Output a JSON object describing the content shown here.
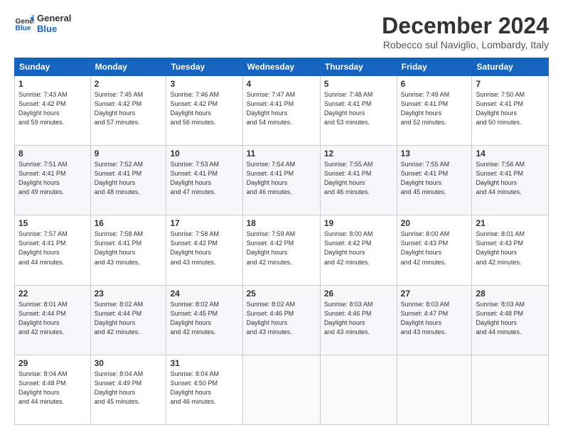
{
  "header": {
    "logo_line1": "General",
    "logo_line2": "Blue",
    "month_title": "December 2024",
    "location": "Robecco sul Naviglio, Lombardy, Italy"
  },
  "days_of_week": [
    "Sunday",
    "Monday",
    "Tuesday",
    "Wednesday",
    "Thursday",
    "Friday",
    "Saturday"
  ],
  "weeks": [
    [
      {
        "day": "1",
        "sunrise": "7:43 AM",
        "sunset": "4:42 PM",
        "daylight": "8 hours and 59 minutes."
      },
      {
        "day": "2",
        "sunrise": "7:45 AM",
        "sunset": "4:42 PM",
        "daylight": "8 hours and 57 minutes."
      },
      {
        "day": "3",
        "sunrise": "7:46 AM",
        "sunset": "4:42 PM",
        "daylight": "8 hours and 56 minutes."
      },
      {
        "day": "4",
        "sunrise": "7:47 AM",
        "sunset": "4:41 PM",
        "daylight": "8 hours and 54 minutes."
      },
      {
        "day": "5",
        "sunrise": "7:48 AM",
        "sunset": "4:41 PM",
        "daylight": "8 hours and 53 minutes."
      },
      {
        "day": "6",
        "sunrise": "7:49 AM",
        "sunset": "4:41 PM",
        "daylight": "8 hours and 52 minutes."
      },
      {
        "day": "7",
        "sunrise": "7:50 AM",
        "sunset": "4:41 PM",
        "daylight": "8 hours and 50 minutes."
      }
    ],
    [
      {
        "day": "8",
        "sunrise": "7:51 AM",
        "sunset": "4:41 PM",
        "daylight": "8 hours and 49 minutes."
      },
      {
        "day": "9",
        "sunrise": "7:52 AM",
        "sunset": "4:41 PM",
        "daylight": "8 hours and 48 minutes."
      },
      {
        "day": "10",
        "sunrise": "7:53 AM",
        "sunset": "4:41 PM",
        "daylight": "8 hours and 47 minutes."
      },
      {
        "day": "11",
        "sunrise": "7:54 AM",
        "sunset": "4:41 PM",
        "daylight": "8 hours and 46 minutes."
      },
      {
        "day": "12",
        "sunrise": "7:55 AM",
        "sunset": "4:41 PM",
        "daylight": "8 hours and 46 minutes."
      },
      {
        "day": "13",
        "sunrise": "7:55 AM",
        "sunset": "4:41 PM",
        "daylight": "8 hours and 45 minutes."
      },
      {
        "day": "14",
        "sunrise": "7:56 AM",
        "sunset": "4:41 PM",
        "daylight": "8 hours and 44 minutes."
      }
    ],
    [
      {
        "day": "15",
        "sunrise": "7:57 AM",
        "sunset": "4:41 PM",
        "daylight": "8 hours and 44 minutes."
      },
      {
        "day": "16",
        "sunrise": "7:58 AM",
        "sunset": "4:41 PM",
        "daylight": "8 hours and 43 minutes."
      },
      {
        "day": "17",
        "sunrise": "7:58 AM",
        "sunset": "4:42 PM",
        "daylight": "8 hours and 43 minutes."
      },
      {
        "day": "18",
        "sunrise": "7:59 AM",
        "sunset": "4:42 PM",
        "daylight": "8 hours and 42 minutes."
      },
      {
        "day": "19",
        "sunrise": "8:00 AM",
        "sunset": "4:42 PM",
        "daylight": "8 hours and 42 minutes."
      },
      {
        "day": "20",
        "sunrise": "8:00 AM",
        "sunset": "4:43 PM",
        "daylight": "8 hours and 42 minutes."
      },
      {
        "day": "21",
        "sunrise": "8:01 AM",
        "sunset": "4:43 PM",
        "daylight": "8 hours and 42 minutes."
      }
    ],
    [
      {
        "day": "22",
        "sunrise": "8:01 AM",
        "sunset": "4:44 PM",
        "daylight": "8 hours and 42 minutes."
      },
      {
        "day": "23",
        "sunrise": "8:02 AM",
        "sunset": "4:44 PM",
        "daylight": "8 hours and 42 minutes."
      },
      {
        "day": "24",
        "sunrise": "8:02 AM",
        "sunset": "4:45 PM",
        "daylight": "8 hours and 42 minutes."
      },
      {
        "day": "25",
        "sunrise": "8:02 AM",
        "sunset": "4:46 PM",
        "daylight": "8 hours and 43 minutes."
      },
      {
        "day": "26",
        "sunrise": "8:03 AM",
        "sunset": "4:46 PM",
        "daylight": "8 hours and 43 minutes."
      },
      {
        "day": "27",
        "sunrise": "8:03 AM",
        "sunset": "4:47 PM",
        "daylight": "8 hours and 43 minutes."
      },
      {
        "day": "28",
        "sunrise": "8:03 AM",
        "sunset": "4:48 PM",
        "daylight": "8 hours and 44 minutes."
      }
    ],
    [
      {
        "day": "29",
        "sunrise": "8:04 AM",
        "sunset": "4:48 PM",
        "daylight": "8 hours and 44 minutes."
      },
      {
        "day": "30",
        "sunrise": "8:04 AM",
        "sunset": "4:49 PM",
        "daylight": "8 hours and 45 minutes."
      },
      {
        "day": "31",
        "sunrise": "8:04 AM",
        "sunset": "4:50 PM",
        "daylight": "8 hours and 46 minutes."
      },
      null,
      null,
      null,
      null
    ]
  ]
}
